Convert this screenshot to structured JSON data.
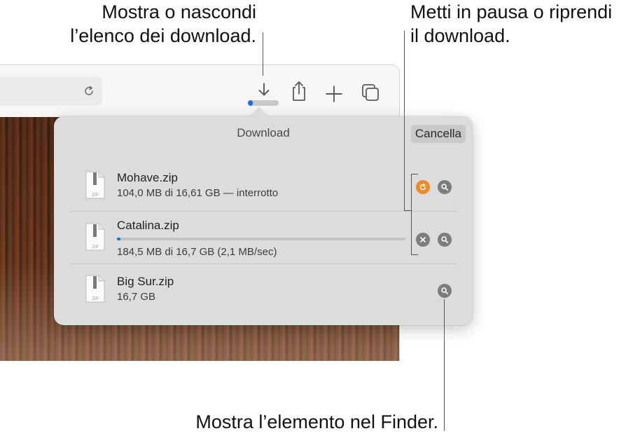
{
  "callouts": {
    "downloads_line1": "Mostra o nascondi",
    "downloads_line2": "l’elenco dei download.",
    "pause_line1": "Metti in pausa o riprendi",
    "pause_line2": "il download.",
    "finder": "Mostra l’elemento nel Finder."
  },
  "toolbar": {
    "icons": [
      "reload-icon",
      "download-arrow-icon",
      "share-icon",
      "new-tab-icon",
      "tab-overview-icon"
    ],
    "download_progress": 0.15
  },
  "downloads": {
    "title": "Download",
    "clear_label": "Cancella",
    "items": [
      {
        "name": "Mohave.zip",
        "status": "104,0 MB di 16,61 GB — interrotto",
        "action": "resume",
        "icon_label": "ZIP"
      },
      {
        "name": "Catalina.zip",
        "status": "184,5 MB di 16,7 GB (2,1 MB/sec)",
        "action": "stop",
        "progress": 0.011,
        "icon_label": "ZIP"
      },
      {
        "name": "Big Sur.zip",
        "status": "16,7 GB",
        "action": "none",
        "icon_label": "ZIP"
      }
    ]
  },
  "colors": {
    "accent_blue": "#1a6cf0",
    "resume_orange": "#f08a24",
    "button_gray": "#7d7d7d"
  }
}
